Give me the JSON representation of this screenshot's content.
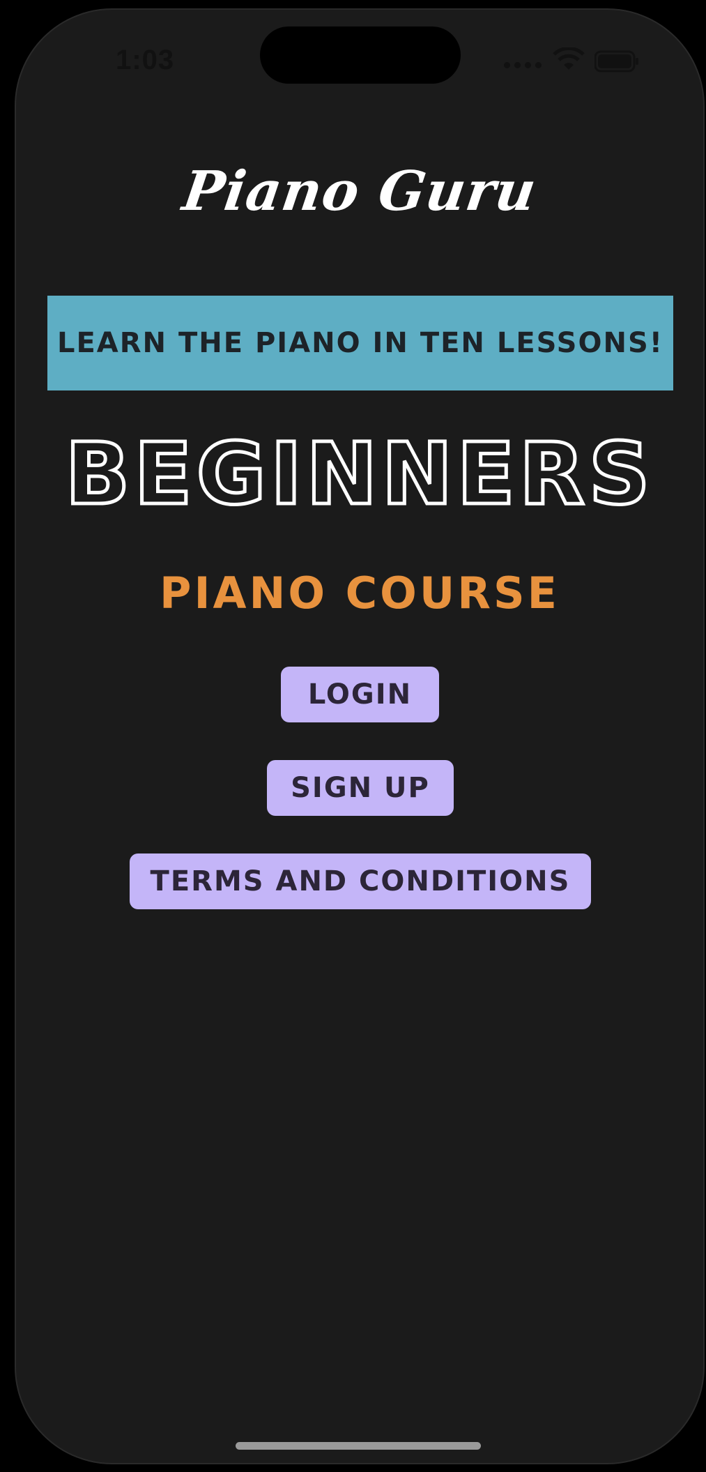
{
  "status_bar": {
    "time": "1:03",
    "icons": [
      "signal-icon",
      "wifi-icon",
      "battery-icon"
    ]
  },
  "app": {
    "title": "Piano Guru",
    "banner": "Learn the piano in ten lessons!",
    "headline": "Beginners",
    "subtitle": "Piano Course"
  },
  "buttons": {
    "login": "Login",
    "sign_up": "Sign Up",
    "terms": "Terms and Conditions"
  },
  "colors": {
    "background": "#1b1b1b",
    "banner": "#5eaec4",
    "subtitle": "#e8923e",
    "button": "#c4b5f8",
    "title": "#ffffff"
  }
}
